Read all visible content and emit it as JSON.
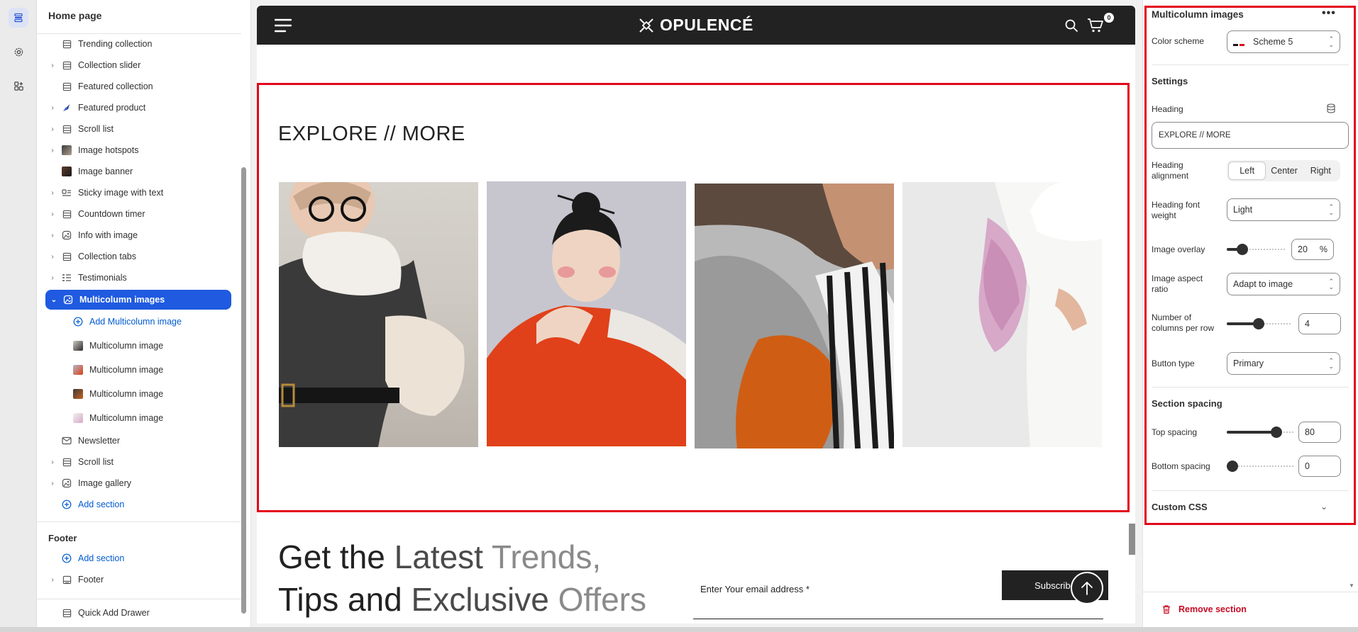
{
  "sidebar": {
    "title": "Home page",
    "items": [
      {
        "label": "Trending collection",
        "chevron": false
      },
      {
        "label": "Collection slider",
        "chevron": true
      },
      {
        "label": "Featured collection",
        "chevron": false
      },
      {
        "label": "Featured product",
        "chevron": true
      },
      {
        "label": "Scroll list",
        "chevron": true
      },
      {
        "label": "Image hotspots",
        "chevron": true
      },
      {
        "label": "Image banner",
        "chevron": false
      },
      {
        "label": "Sticky image with text",
        "chevron": true
      },
      {
        "label": "Countdown timer",
        "chevron": true
      },
      {
        "label": "Info with image",
        "chevron": true
      },
      {
        "label": "Collection tabs",
        "chevron": true
      },
      {
        "label": "Testimonials",
        "chevron": true
      }
    ],
    "selected": "Multicolumn images",
    "add_block": "Add Multicolumn image",
    "children": [
      "Multicolumn image",
      "Multicolumn image",
      "Multicolumn image",
      "Multicolumn image"
    ],
    "after": [
      {
        "label": "Newsletter",
        "chevron": false
      },
      {
        "label": "Scroll list",
        "chevron": true
      },
      {
        "label": "Image gallery",
        "chevron": true
      }
    ],
    "add_section": "Add section",
    "footer_heading": "Footer",
    "footer_add_section": "Add section",
    "footer_item": "Footer",
    "quick_add": "Quick Add Drawer"
  },
  "preview": {
    "brand": "OPULENCÉ",
    "cart_count": "0",
    "multicolumn_heading": "EXPLORE // MORE",
    "newsletter": {
      "line1_a": "Get the ",
      "line1_b": "Latest ",
      "line1_c": "Trends,",
      "line2_a": "Tips and ",
      "line2_b": "Exclusive ",
      "line2_c": "Offers",
      "email_label": "Enter Your email address *",
      "button": "Subscribe"
    }
  },
  "panel": {
    "title": "Multicolumn images",
    "color_scheme_label": "Color scheme",
    "color_scheme_value": "Scheme 5",
    "settings_heading": "Settings",
    "heading_label": "Heading",
    "heading_value": "EXPLORE // MORE",
    "heading_alignment_label": "Heading alignment",
    "alignment_options": [
      "Left",
      "Center",
      "Right"
    ],
    "alignment_selected": "Left",
    "font_weight_label": "Heading font weight",
    "font_weight_value": "Light",
    "image_overlay_label": "Image overlay",
    "image_overlay_value": "20",
    "image_overlay_unit": "%",
    "image_overlay_level": 0.2,
    "aspect_label": "Image aspect ratio",
    "aspect_value": "Adapt to image",
    "columns_label": "Number of columns per row",
    "columns_value": "4",
    "columns_level": 0.5,
    "button_type_label": "Button type",
    "button_type_value": "Primary",
    "section_spacing_heading": "Section spacing",
    "top_spacing_label": "Top spacing",
    "top_spacing_value": "80",
    "top_spacing_level": 0.8,
    "bottom_spacing_label": "Bottom spacing",
    "bottom_spacing_value": "0",
    "bottom_spacing_level": 0,
    "custom_css_heading": "Custom CSS",
    "remove_label": "Remove section"
  },
  "colors": {
    "accent": "#1f5ae0",
    "highlight": "#e2061b",
    "header_bg": "#222222",
    "danger": "#c70a24"
  }
}
